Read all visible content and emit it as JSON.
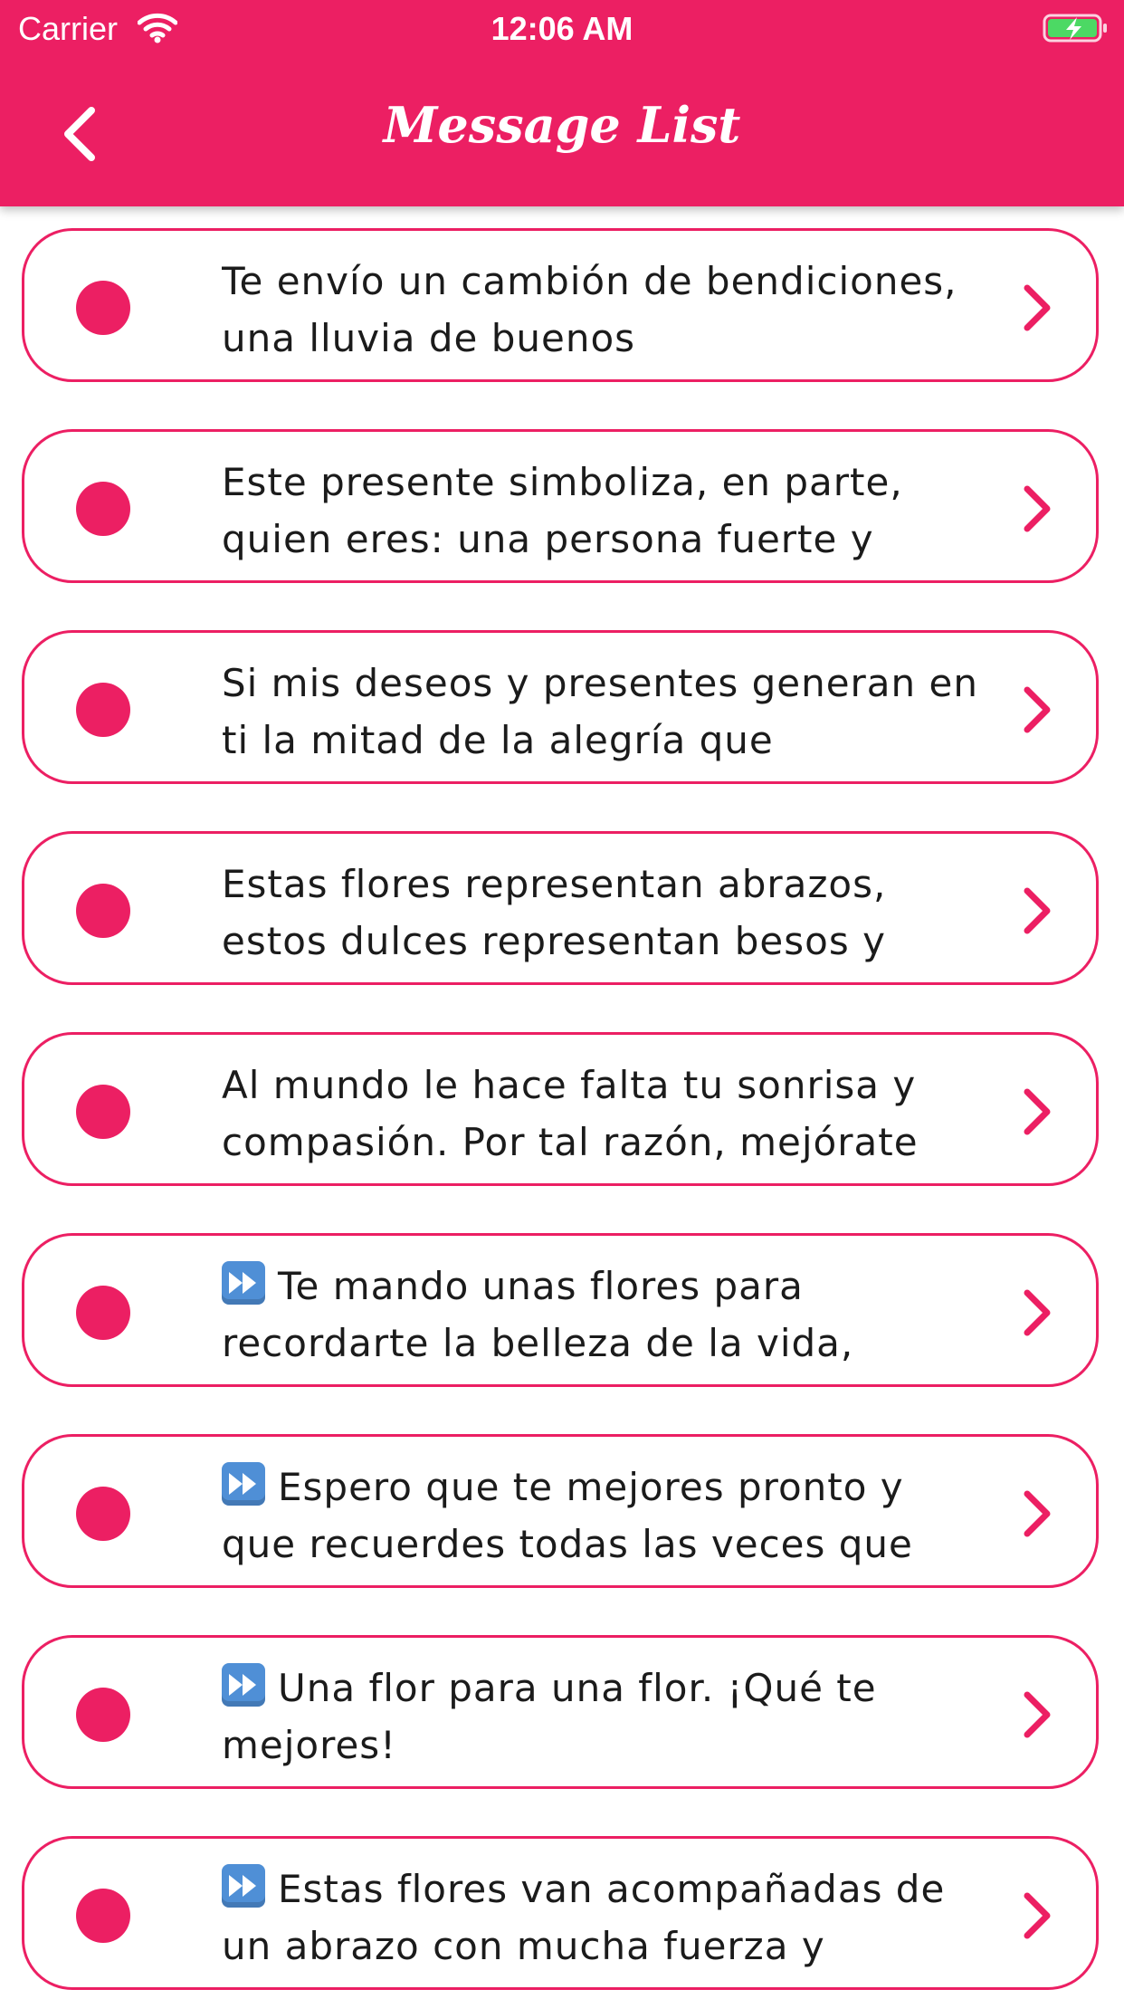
{
  "status_bar": {
    "carrier": "Carrier",
    "time": "12:06 AM"
  },
  "header": {
    "title": "Message List",
    "accent_color": "#EC1F63"
  },
  "messages": [
    {
      "prefix": "",
      "text": "Te envío un cambión de bendiciones, una lluvia de buenos"
    },
    {
      "prefix": "",
      "text": "Este presente simboliza, en parte, quien eres: una persona fuerte y"
    },
    {
      "prefix": "",
      "text": "Si mis deseos y presentes generan en ti la mitad de la alegría que"
    },
    {
      "prefix": "",
      "text": "Estas flores representan abrazos, estos dulces representan besos y"
    },
    {
      "prefix": "",
      "text": "Al mundo le hace falta tu sonrisa y compasión. Por tal razón, mejórate"
    },
    {
      "prefix": "fast-forward-icon",
      "text": "Te mando unas flores para recordarte la belleza de la vida,"
    },
    {
      "prefix": "fast-forward-icon",
      "text": "Espero que te mejores pronto y que recuerdes todas las veces que"
    },
    {
      "prefix": "fast-forward-icon",
      "text": "Una flor para una flor. ¡Qué te mejores!"
    },
    {
      "prefix": "fast-forward-icon",
      "text": "Estas flores van acompañadas de un abrazo con mucha fuerza y"
    }
  ]
}
